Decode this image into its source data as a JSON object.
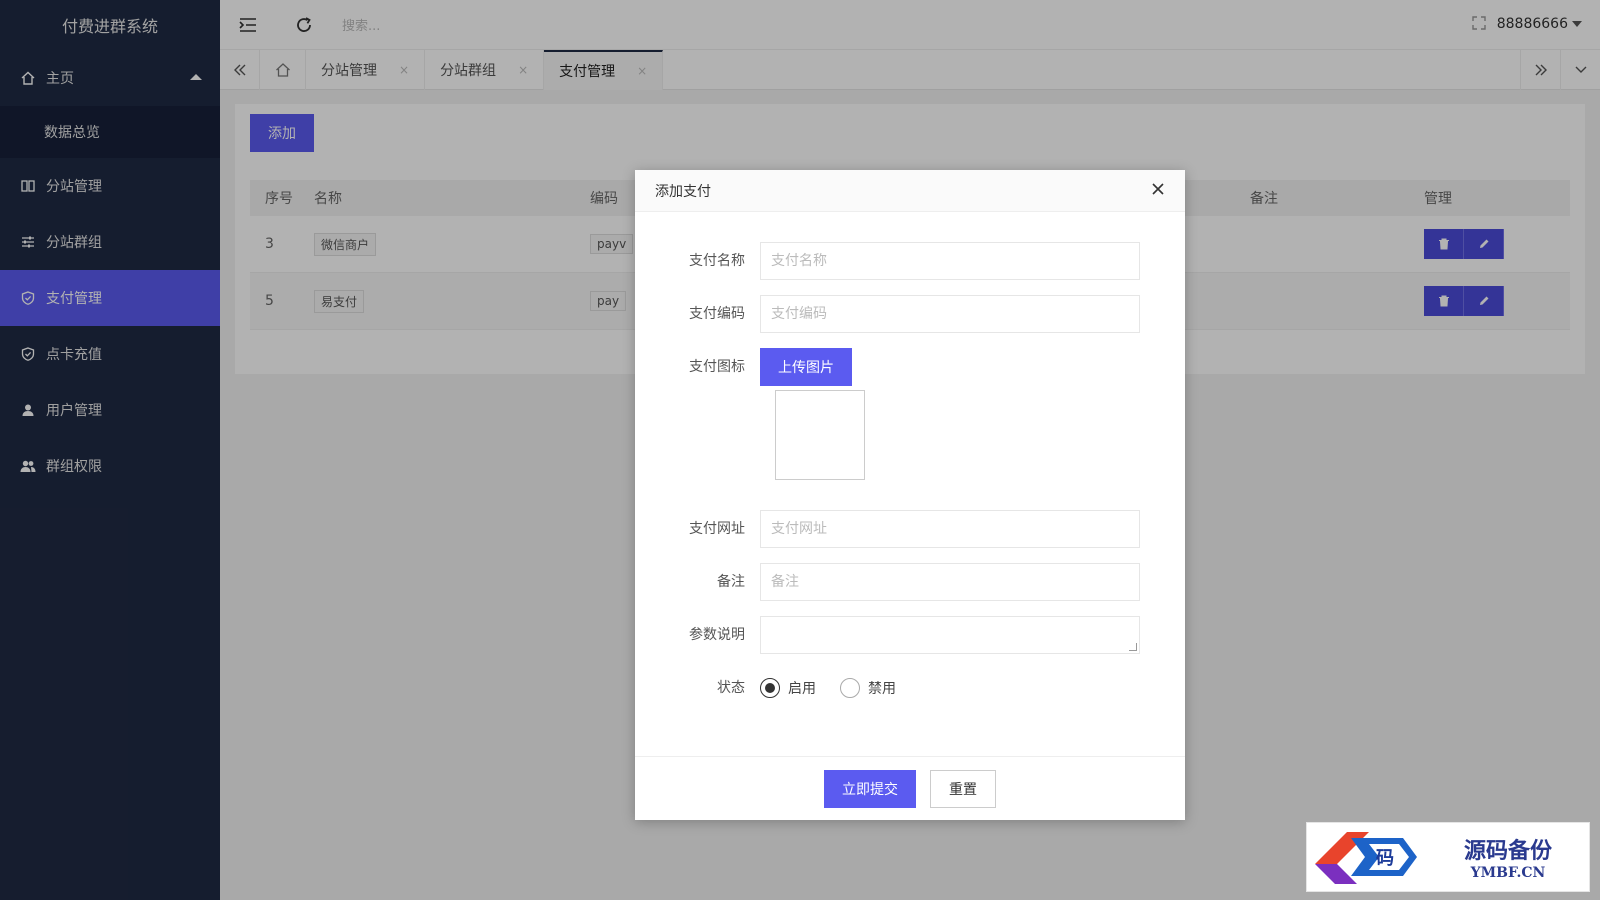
{
  "app": {
    "brand": "付费进群系统"
  },
  "sidebar": {
    "home_group": "主页",
    "home_sub": "数据总览",
    "items": [
      {
        "label": "分站管理",
        "icon": "columns-icon"
      },
      {
        "label": "分站群组",
        "icon": "sliders-icon"
      },
      {
        "label": "支付管理",
        "icon": "shield-icon",
        "active": true
      },
      {
        "label": "点卡充值",
        "icon": "shield-icon"
      },
      {
        "label": "用户管理",
        "icon": "user-icon"
      },
      {
        "label": "群组权限",
        "icon": "users-icon"
      }
    ]
  },
  "topbar": {
    "search_placeholder": "搜索...",
    "username": "88886666"
  },
  "tabs": [
    {
      "label": "分站管理",
      "close": "×"
    },
    {
      "label": "分站群组",
      "close": "×"
    },
    {
      "label": "支付管理",
      "close": "×",
      "active": true
    }
  ],
  "page": {
    "add_button": "添加",
    "table": {
      "headers": [
        "序号",
        "名称",
        "编码",
        "备注",
        "管理"
      ],
      "rows": [
        {
          "no": "3",
          "name": "微信商户",
          "code": "payv"
        },
        {
          "no": "5",
          "name": "易支付",
          "code": "pay"
        }
      ]
    }
  },
  "modal": {
    "title": "添加支付",
    "fields": {
      "name_label": "支付名称",
      "name_placeholder": "支付名称",
      "code_label": "支付编码",
      "code_placeholder": "支付编码",
      "icon_label": "支付图标",
      "upload_button": "上传图片",
      "url_label": "支付网址",
      "url_placeholder": "支付网址",
      "remark_label": "备注",
      "remark_placeholder": "备注",
      "params_label": "参数说明",
      "status_label": "状态",
      "status_on": "启用",
      "status_off": "禁用",
      "status_selected": "启用"
    },
    "submit_button": "立即提交",
    "reset_button": "重置"
  },
  "watermark": {
    "cn": "源码备份",
    "en": "YMBF.CN",
    "logo_char": "码"
  },
  "colors": {
    "sidebar_bg": "#1f2a44",
    "accent": "#5b5bf0",
    "action_btn": "#4b4bd8"
  }
}
